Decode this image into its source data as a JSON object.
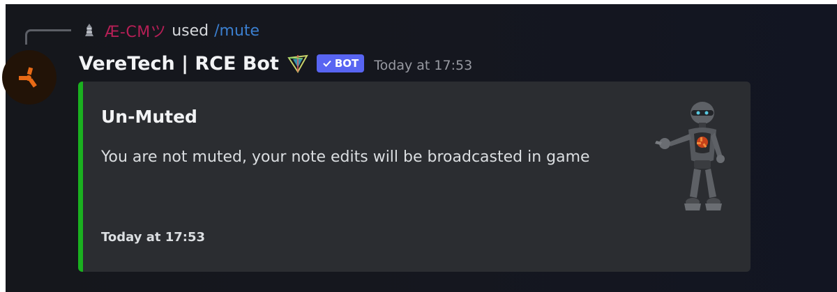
{
  "reply": {
    "user": "Æ-CMツ",
    "used_text": "used",
    "command": "/mute",
    "user_color": "#b51f56",
    "command_color": "#3b7fd0"
  },
  "message": {
    "author": "VereTech | RCE Bot",
    "badge_label": "BOT",
    "timestamp": "Today at 17:53",
    "avatar_icon": "rust-logo-icon",
    "decoration_icon": "crystal-icon"
  },
  "embed": {
    "accent_color": "#1ab01f",
    "title": "Un-Muted",
    "description": "You are not muted, your note edits will be broadcasted in game",
    "footer_timestamp": "Today at 17:53",
    "thumbnail_icon": "robot-thumbnail-icon"
  }
}
